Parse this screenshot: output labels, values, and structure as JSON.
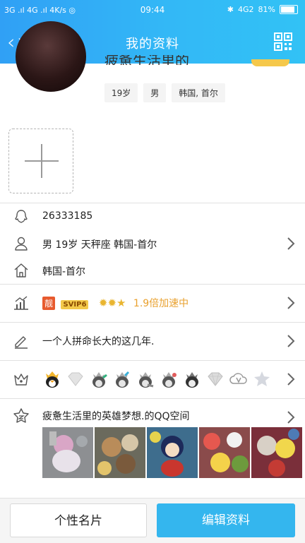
{
  "status_bar": {
    "signal_left": "3G .ıl 4G .ıl 4K/s ◎",
    "time": "09:44",
    "network": "4G2",
    "battery": "81%"
  },
  "nav": {
    "back_label": "返回",
    "title": "我的资料"
  },
  "profile": {
    "nickname_fragment": "疲惫生活里的",
    "chips": [
      "19岁",
      "男",
      "韩国, 首尔"
    ]
  },
  "rows": {
    "qq_number": "26333185",
    "basic_info": "男  19岁  天秤座  韩国-首尔",
    "hometown": "韩国-首尔",
    "vip": {
      "red_badge": "靓",
      "svip_badge": "SVIP6",
      "level_icons": "✹✹★",
      "speed_text": "1.9倍加速中"
    },
    "signature": "一个人拼命长大的这几年.",
    "qzone_title": "疲惫生活里的英雄梦想.的QQ空间"
  },
  "buttons": {
    "profile_card": "个性名片",
    "edit_profile": "编辑资料"
  },
  "icons": [
    "back-icon",
    "qr-code-icon",
    "qq-icon",
    "person-icon",
    "home-icon",
    "level-chart-icon",
    "pencil-icon",
    "crown-icon",
    "star-icon",
    "chevron-right-icon",
    "plus-icon"
  ],
  "colors": {
    "header": "#33b5f5",
    "edit_button": "#34b6ee",
    "vip_red": "#e75a2e",
    "svip_gold": "#f3c94a",
    "speed_text": "#e9a12f"
  }
}
